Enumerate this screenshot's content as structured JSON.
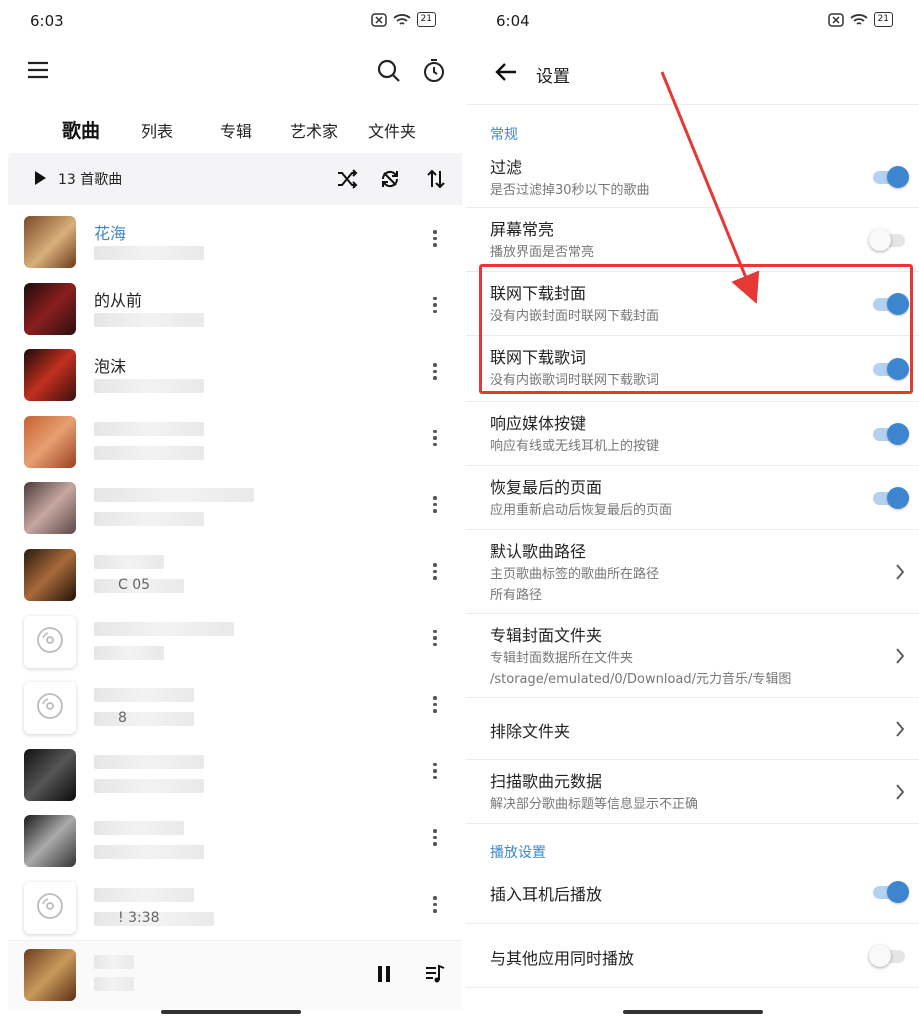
{
  "left": {
    "status": {
      "time": "6:03",
      "battery": "21"
    },
    "tabs": [
      "歌曲",
      "列表",
      "专辑",
      "艺术家",
      "文件夹"
    ],
    "song_count": "13 首歌曲",
    "songs": [
      {
        "title": "花海",
        "subtitle": "",
        "highlight": true
      },
      {
        "title": "的从前",
        "subtitle": "",
        "highlight": false
      },
      {
        "title": "泡沫",
        "subtitle": "",
        "highlight": false
      },
      {
        "title": "",
        "subtitle": "",
        "highlight": false
      },
      {
        "title": "",
        "subtitle": "",
        "highlight": false
      },
      {
        "title": "",
        "subtitle": "C 05",
        "highlight": false
      },
      {
        "title": "",
        "subtitle": "",
        "highlight": false
      },
      {
        "title": "",
        "subtitle": "8",
        "highlight": false
      },
      {
        "title": "",
        "subtitle": "",
        "highlight": false
      },
      {
        "title": "",
        "subtitle": "",
        "highlight": false
      },
      {
        "title": "",
        "subtitle": "! 3:38",
        "highlight": false
      }
    ]
  },
  "right": {
    "status": {
      "time": "6:04",
      "battery": "21"
    },
    "title": "设置",
    "sections": {
      "general": "常规",
      "playback": "播放设置"
    },
    "settings": [
      {
        "title": "过滤",
        "subtitle": "是否过滤掉30秒以下的歌曲",
        "control": "toggle",
        "on": true
      },
      {
        "title": "屏幕常亮",
        "subtitle": "播放界面是否常亮",
        "control": "toggle",
        "on": false
      },
      {
        "title": "联网下载封面",
        "subtitle": "没有内嵌封面时联网下载封面",
        "control": "toggle",
        "on": true
      },
      {
        "title": "联网下载歌词",
        "subtitle": "没有内嵌歌词时联网下载歌词",
        "control": "toggle",
        "on": true
      },
      {
        "title": "响应媒体按键",
        "subtitle": "响应有线或无线耳机上的按键",
        "control": "toggle",
        "on": true
      },
      {
        "title": "恢复最后的页面",
        "subtitle": "应用重新启动后恢复最后的页面",
        "control": "toggle",
        "on": true
      },
      {
        "title": "默认歌曲路径",
        "subtitle": "主页歌曲标签的歌曲所在路径",
        "subtitle2": "所有路径",
        "control": "chevron"
      },
      {
        "title": "专辑封面文件夹",
        "subtitle": "专辑封面数据所在文件夹",
        "subtitle2": "/storage/emulated/0/Download/元力音乐/专辑图",
        "control": "chevron"
      },
      {
        "title": "排除文件夹",
        "subtitle": "",
        "control": "chevron"
      },
      {
        "title": "扫描歌曲元数据",
        "subtitle": "解决部分歌曲标题等信息显示不正确",
        "control": "chevron"
      },
      {
        "title": "插入耳机后播放",
        "subtitle": "",
        "control": "toggle",
        "on": true
      },
      {
        "title": "与其他应用同时播放",
        "subtitle": "",
        "control": "toggle",
        "on": false
      }
    ]
  },
  "colors": {
    "accent": "#3d86cf",
    "annotation": "#e53935"
  },
  "icons": [
    "menu-icon",
    "search-icon",
    "timer-icon",
    "play-icon",
    "shuffle-icon",
    "repeat-icon",
    "sort-icon",
    "more-vert-icon",
    "pause-icon",
    "queue-icon",
    "back-arrow-icon",
    "chevron-right-icon",
    "wifi-icon",
    "mute-icon",
    "battery-icon",
    "disc-icon"
  ]
}
